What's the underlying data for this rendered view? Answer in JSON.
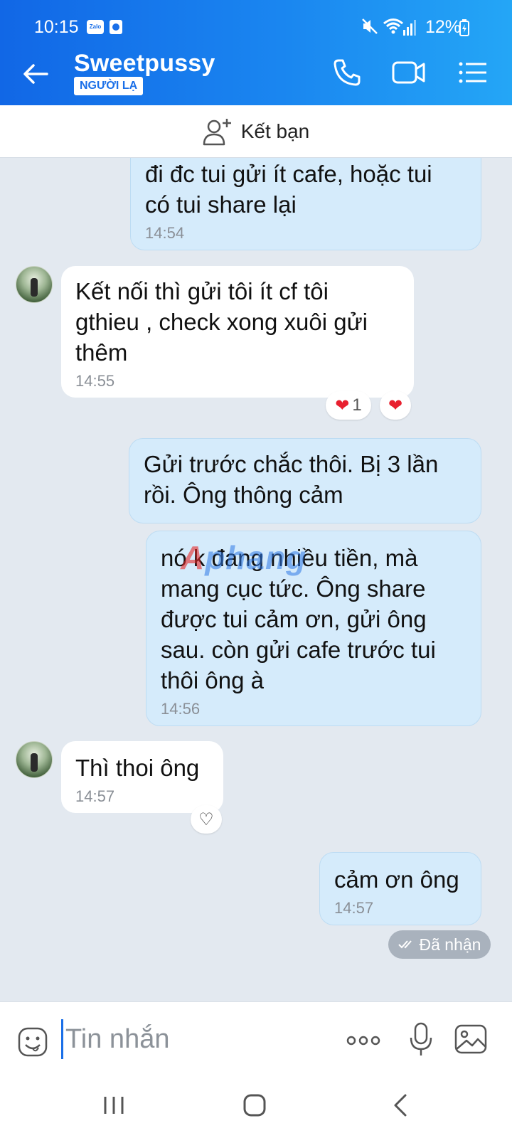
{
  "status_bar": {
    "time": "10:15",
    "zalo_icon_text": "Zalo",
    "battery": "12%"
  },
  "header": {
    "contact_name": "Sweetpussy",
    "badge": "NGƯỜI LẠ",
    "icons": [
      "back-arrow-icon",
      "phone-icon",
      "video-call-icon",
      "menu-list-icon"
    ]
  },
  "add_friend": {
    "label": "Kết bạn"
  },
  "messages": [
    {
      "direction": "out",
      "text_lines": [
        "đi đc tui gửi ít cafe, hoặc tui",
        "có tui share lại"
      ],
      "time": "14:54"
    },
    {
      "direction": "in",
      "text_lines": [
        "Kết nối thì gửi tôi ít cf tôi",
        "gthieu , check xong xuôi gửi",
        "thêm"
      ],
      "time": "14:55",
      "reactions": [
        {
          "emoji": "❤",
          "count": "1"
        },
        {
          "emoji": "❤",
          "count": ""
        }
      ]
    },
    {
      "direction": "out",
      "text_lines": [
        "Gửi trước chắc thôi. Bị 3 lần",
        "rồi. Ông thông cảm"
      ],
      "time": ""
    },
    {
      "direction": "out",
      "text_lines": [
        "nó k đang nhiều tiền, mà",
        "mang cục tức. Ông share",
        "được tui cảm ơn, gửi ông",
        "sau. còn gửi cafe trước tui",
        "thôi ông à"
      ],
      "time": "14:56"
    },
    {
      "direction": "in",
      "text_lines": [
        "Thì thoi ông"
      ],
      "time": "14:57",
      "reactions": [
        {
          "emoji": "♡",
          "count": ""
        }
      ]
    },
    {
      "direction": "out",
      "text_lines": [
        "cảm ơn ông"
      ],
      "time": "14:57"
    }
  ],
  "watermark": {
    "first": "A",
    "rest": "phang"
  },
  "delivery_status": "Đã nhận",
  "composer": {
    "placeholder": "Tin nhắn"
  },
  "colors": {
    "header_start": "#1167e6",
    "header_end": "#24a6f6",
    "outgoing_bubble": "#d5ebfb",
    "incoming_bubble": "#ffffff",
    "chat_background": "#e3e9f0",
    "heart": "#e8202f"
  }
}
